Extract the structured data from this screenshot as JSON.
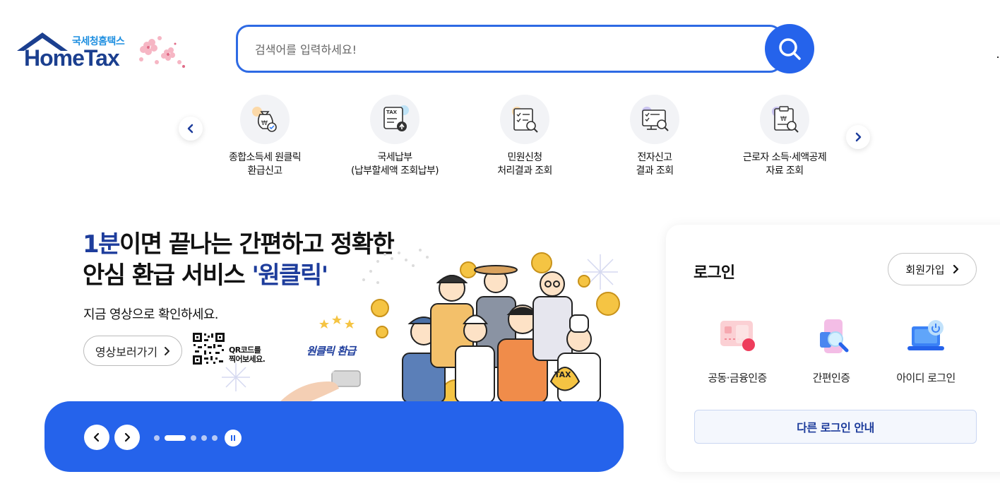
{
  "header": {
    "logo_sub": "국세청홈택스",
    "logo_main": "HomeTax",
    "search": {
      "placeholder": "검색어를 입력하세요!",
      "icon": "search-icon"
    }
  },
  "quick_menu": {
    "items": [
      {
        "line1": "종합소득세 원클릭",
        "line2": "환급신고",
        "icon": "refund-bag-icon"
      },
      {
        "line1": "국세납부",
        "line2": "(납부할세액 조회납부)",
        "icon": "tax-upload-icon"
      },
      {
        "line1": "민원신청",
        "line2": "처리결과 조회",
        "icon": "checklist-search-icon"
      },
      {
        "line1": "전자신고",
        "line2": "결과 조회",
        "icon": "monitor-search-icon"
      },
      {
        "line1": "근로자 소득·세액공제",
        "line2": "자료 조회",
        "icon": "clipboard-search-icon"
      }
    ]
  },
  "banner": {
    "title_hl": "1분",
    "title_rest": "이면 끝나는 간편하고 정확한",
    "title_line2": "안심 환급 서비스 ",
    "title_line2_hl": "'원클릭'",
    "subtitle": "지금 영상으로 확인하세요.",
    "video_button": "영상보러가기",
    "qr_line1": "QR코드를",
    "qr_line2": "찍어보세요.",
    "illustration_label": "원클릭 환급",
    "slides_total": 5,
    "slide_active": 2
  },
  "login": {
    "title": "로그인",
    "join_button": "회원가입",
    "options": [
      {
        "label": "공동·금융인증",
        "icon": "certificate-card-icon"
      },
      {
        "label": "간편인증",
        "icon": "phone-search-icon"
      },
      {
        "label": "아이디 로그인",
        "icon": "laptop-power-icon"
      }
    ],
    "other_login": "다른 로그인 안내"
  },
  "colors": {
    "accent": "#2563eb",
    "brand_navy": "#1e3d9c"
  }
}
